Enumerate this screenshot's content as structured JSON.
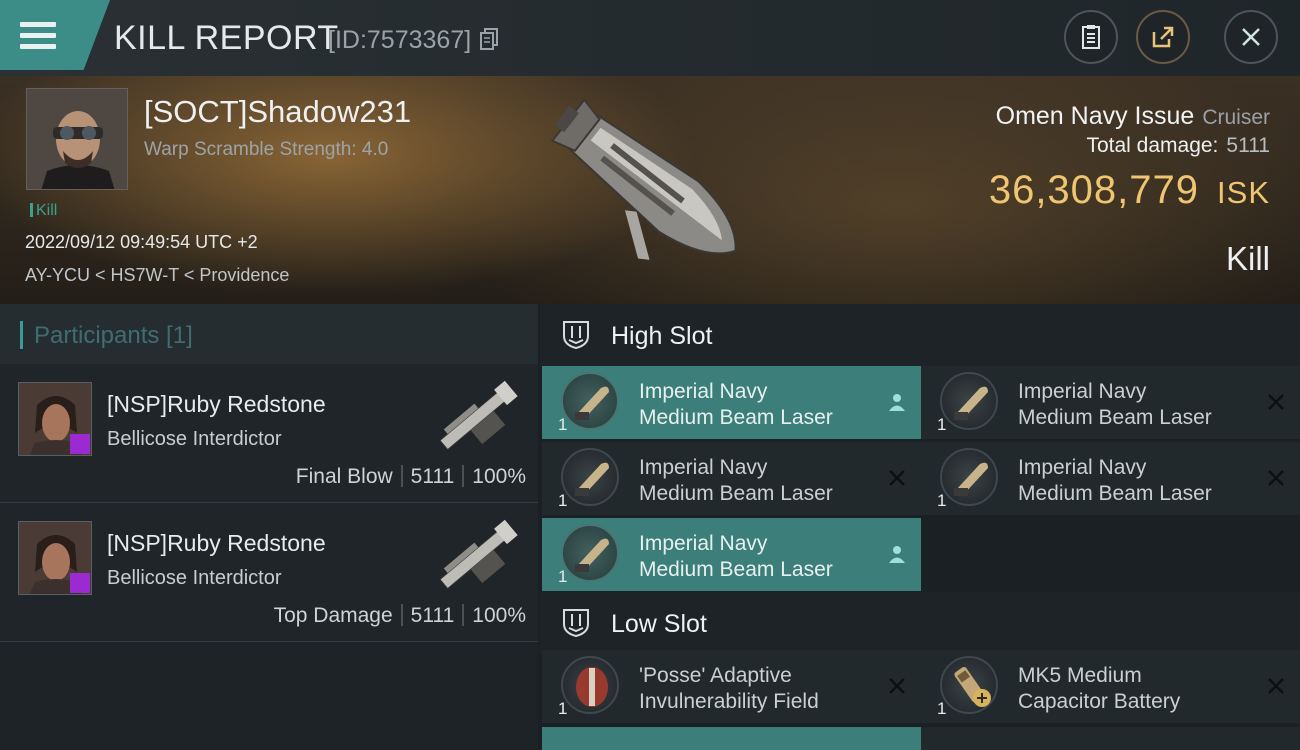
{
  "header": {
    "title": "KILL REPORT",
    "report_id": "[ID:7573367]"
  },
  "victim": {
    "name": "[SOCT]Shadow231",
    "scramble": "Warp Scramble Strength: 4.0",
    "tag": "Kill",
    "datetime": "2022/09/12 09:49:54 UTC +2",
    "location": "AY-YCU < HS7W-T < Providence",
    "ship": "Omen Navy Issue",
    "ship_class": "Cruiser",
    "total_damage_label": "Total damage:",
    "total_damage": "5111",
    "isk_value": "36,308,779",
    "isk_unit": "ISK",
    "result": "Kill"
  },
  "participants": {
    "label": "Participants [1]",
    "items": [
      {
        "name": "[NSP]Ruby Redstone",
        "ship": "Bellicose Interdictor",
        "role": "Final Blow",
        "damage": "5111",
        "percent": "100%"
      },
      {
        "name": "[NSP]Ruby Redstone",
        "ship": "Bellicose Interdictor",
        "role": "Top Damage",
        "damage": "5111",
        "percent": "100%"
      }
    ]
  },
  "fitting": {
    "high_slot_label": "High Slot",
    "low_slot_label": "Low Slot",
    "high": [
      {
        "line1": "Imperial Navy",
        "line2": "Medium Beam Laser",
        "qty": "1",
        "status": "dropped"
      },
      {
        "line1": "Imperial Navy",
        "line2": "Medium Beam Laser",
        "qty": "1",
        "status": "destroyed"
      },
      {
        "line1": "Imperial Navy",
        "line2": "Medium Beam Laser",
        "qty": "1",
        "status": "destroyed"
      },
      {
        "line1": "Imperial Navy",
        "line2": "Medium Beam Laser",
        "qty": "1",
        "status": "destroyed"
      },
      {
        "line1": "Imperial Navy",
        "line2": "Medium Beam Laser",
        "qty": "1",
        "status": "dropped"
      }
    ],
    "low": [
      {
        "line1": "'Posse' Adaptive",
        "line2": "Invulnerability Field",
        "qty": "1",
        "status": "destroyed"
      },
      {
        "line1": "MK5 Medium",
        "line2": "Capacitor Battery",
        "qty": "1",
        "status": "destroyed"
      }
    ]
  },
  "colors": {
    "accent": "#3c8c88",
    "isk": "#f0c572",
    "dropped_bg": "#3b7e7a",
    "alliance": "#9b2ad1"
  }
}
